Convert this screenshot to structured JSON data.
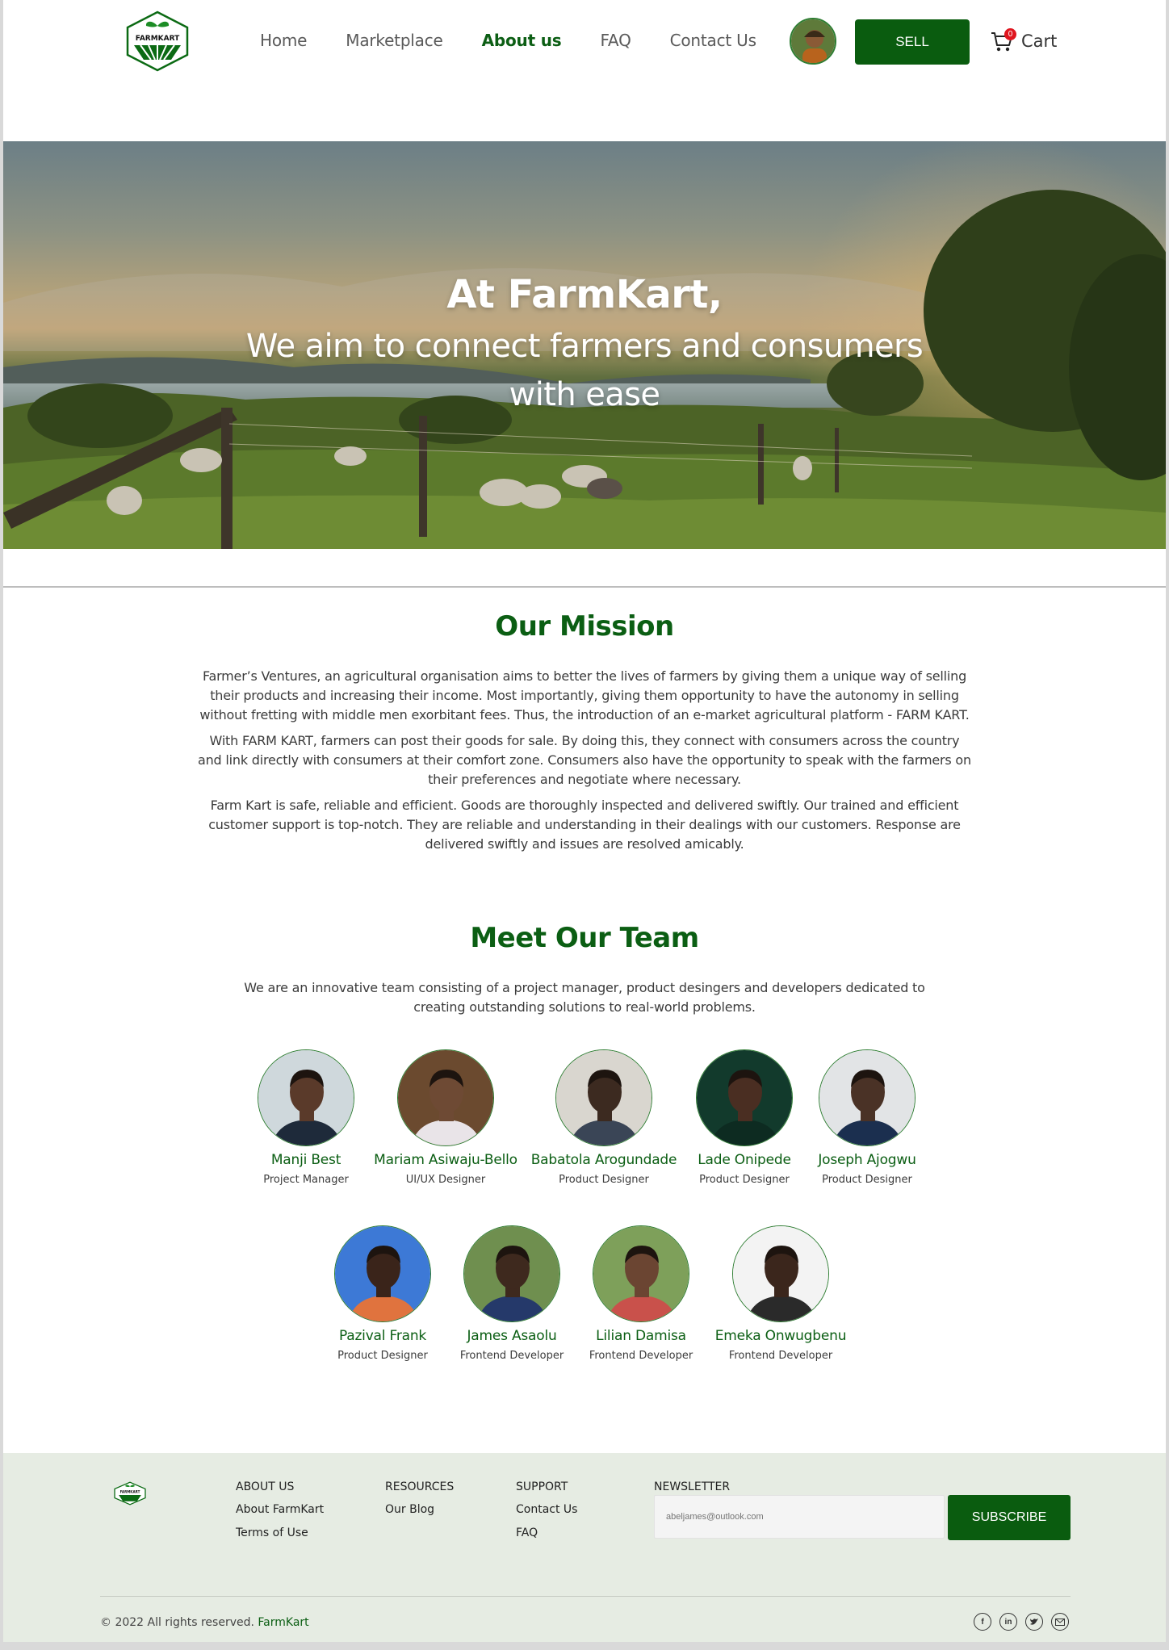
{
  "brand": {
    "logo_text": "FARMKART"
  },
  "nav": {
    "links": [
      "Home",
      "Marketplace",
      "About us",
      "FAQ",
      "Contact Us"
    ],
    "active": "About us",
    "sell_label": "SELL",
    "cart_label": "Cart",
    "cart_count": "0"
  },
  "hero": {
    "title": "At FarmKart,",
    "subtitle_line1": "We aim to connect farmers and consumers",
    "subtitle_line2": "with ease"
  },
  "mission": {
    "title": "Our Mission",
    "paragraphs": [
      "Farmer’s Ventures, an agricultural organisation aims to better the lives of farmers by giving them a unique way of selling their products and increasing their income. Most importantly, giving them opportunity to have the autonomy in selling without fretting with middle men exorbitant fees. Thus, the introduction of an e-market agricultural platform - FARM KART.",
      "With FARM KART, farmers can post their goods for sale. By doing this, they connect with consumers across the country and link directly with consumers at their comfort zone. Consumers also have the opportunity to speak with the farmers on their preferences and negotiate where necessary.",
      "Farm Kart is safe, reliable and efficient. Goods are thoroughly inspected and delivered swiftly. Our trained and efficient customer support is top-notch. They are reliable and understanding in their dealings with our customers. Response are delivered swiftly and issues are resolved amicably."
    ]
  },
  "team": {
    "title": "Meet Our Team",
    "intro": "We are an innovative team consisting of a project manager, product desingers and developers dedicated to creating outstanding solutions to real-world problems.",
    "members": [
      {
        "name": "Manji Best",
        "role": "Project Manager",
        "bg": "#cfd8dc",
        "skin": "#5a3a2a",
        "shirt": "#1e2a3a"
      },
      {
        "name": "Mariam Asiwaju-Bello",
        "role": "UI/UX Designer",
        "bg": "#6b4a2f",
        "skin": "#6e4a34",
        "shirt": "#e9e4e8"
      },
      {
        "name": "Babatola Arogundade",
        "role": "Product Designer",
        "bg": "#d9d6cf",
        "skin": "#3c2a20",
        "shirt": "#3a4556"
      },
      {
        "name": "Lade Onipede",
        "role": "Product Designer",
        "bg": "#123a2c",
        "skin": "#4a2e22",
        "shirt": "#0d2b21"
      },
      {
        "name": "Joseph Ajogwu",
        "role": "Product Designer",
        "bg": "#e2e4e6",
        "skin": "#4a3226",
        "shirt": "#1b2f4f"
      },
      {
        "name": "Pazival Frank",
        "role": "Product Designer",
        "bg": "#3d79d6",
        "skin": "#3a241a",
        "shirt": "#e0733e"
      },
      {
        "name": "James Asaolu",
        "role": "Frontend Developer",
        "bg": "#6f8f4f",
        "skin": "#3e291e",
        "shirt": "#25396a"
      },
      {
        "name": "Lilian Damisa",
        "role": "Frontend Developer",
        "bg": "#7ea05a",
        "skin": "#6b4532",
        "shirt": "#c9514b"
      },
      {
        "name": "Emeka Onwugbenu",
        "role": "Frontend Developer",
        "bg": "#f3f3f3",
        "skin": "#3b261c",
        "shirt": "#2a2a2a"
      }
    ]
  },
  "footer": {
    "about_head": "ABOUT US",
    "about_links": [
      "About FarmKart",
      "Terms of Use"
    ],
    "resources_head": "RESOURCES",
    "resources_links": [
      "Our Blog"
    ],
    "support_head": "SUPPORT",
    "support_links": [
      "Contact Us",
      "FAQ"
    ],
    "newsletter_head": "NEWSLETTER",
    "newsletter_placeholder": "abeljames@outlook.com",
    "subscribe_label": "SUBSCRIBE",
    "copyright": "© 2022 All rights reserved.",
    "copyright_brand": "FarmKart",
    "socials": [
      "facebook-icon",
      "linkedin-icon",
      "twitter-icon",
      "mail-icon"
    ]
  },
  "colors": {
    "primary": "#0a5c0f",
    "footer_bg": "#e6ece3",
    "badge": "#e0161f"
  }
}
